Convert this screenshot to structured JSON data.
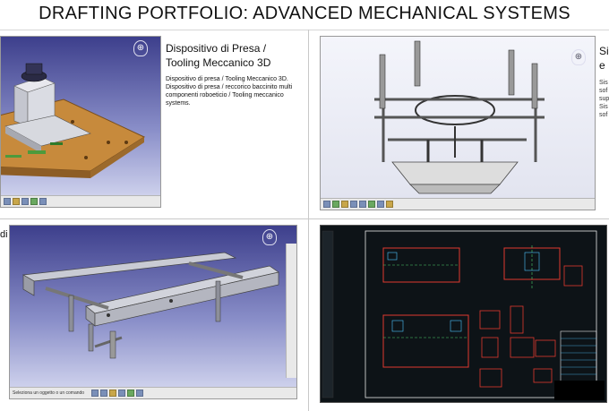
{
  "page": {
    "title": "DRAFTING PORTFOLIO: ADVANCED MECHANICAL SYSTEMS"
  },
  "panels": {
    "top_left": {
      "heading_line1": "Dispositivo di Presa /",
      "heading_line2": "Tooling Meccanico 3D",
      "description": "Dispositivo di presa / Tooling Meccanico 3D. Dispositivo di presa / reccorico baccinito multi componenti roboeticio / Tooling meccanico systems."
    },
    "top_right": {
      "heading_fragment_1": "Si",
      "heading_fragment_2": "e",
      "desc_fragments": [
        "Sis",
        "sof",
        "sup",
        "Sis",
        "sof"
      ]
    },
    "bottom_left": {
      "side_fragment": "di",
      "status_text": "Seleziona un oggetto o un comando"
    }
  },
  "colors": {
    "viewport_top": "#3d3f8c",
    "viewport_bottom": "#d9dcf2",
    "tooling_plate": "#c78a3c",
    "frame_steel": "#b9bcc4",
    "cad_red": "#e03a2f",
    "cad_green": "#4fd06a",
    "cad_cyan": "#4fc6ff"
  },
  "icons": {
    "compass": "compass-icon",
    "toolbar": "toolbar-button-icon"
  }
}
